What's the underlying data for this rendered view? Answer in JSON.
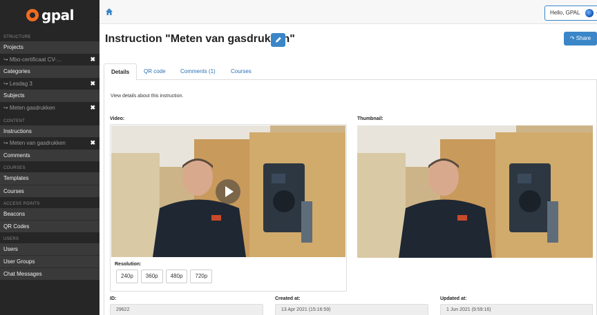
{
  "sidebar": {
    "logo_text": "gpal",
    "sections": {
      "structure": "STRUCTURE",
      "content": "CONTENT",
      "courses": "COURSES",
      "access_points": "ACCESS POINTS",
      "users": "USERS"
    },
    "items": {
      "projects": "Projects",
      "project_sub": "↪ Mbo-certificaat CV-...",
      "categories": "Categories",
      "category_sub": "↪ Lesdag 3",
      "subjects": "Subjects",
      "subject_sub": "↪ Meten gasdrukken",
      "instructions": "Instructions",
      "instruction_sub": "↪ Meten van gasdrukken",
      "comments": "Comments",
      "templates": "Templates",
      "courses": "Courses",
      "beacons": "Beacons",
      "qr_codes": "QR Codes",
      "users": "Users",
      "user_groups": "User Groups",
      "chat_messages": "Chat Messages"
    },
    "remove_glyph": "✖"
  },
  "topbar": {
    "hello": "Hello, GPAL"
  },
  "page": {
    "title": "Instruction \"Meten van gasdrukken\"",
    "share_label": "Share",
    "tabs": [
      "Details",
      "QR code",
      "Comments (1)",
      "Courses"
    ],
    "description": "View details about this instruction.",
    "video_label": "Video:",
    "thumbnail_label": "Thumbnail:",
    "resolution_label": "Resolution:",
    "resolutions": [
      "240p",
      "360p",
      "480p",
      "720p"
    ],
    "id_label": "ID:",
    "id_value": "29622",
    "created_label": "Created at:",
    "created_value": "13 Apr 2021 (15:16:59)",
    "updated_label": "Updated at:",
    "updated_value": "1 Jun 2021 (9:59:16)"
  },
  "colors": {
    "sidebar_bg": "#262626",
    "accent_blue": "#3a86c8",
    "logo_orange": "#f26b21"
  }
}
